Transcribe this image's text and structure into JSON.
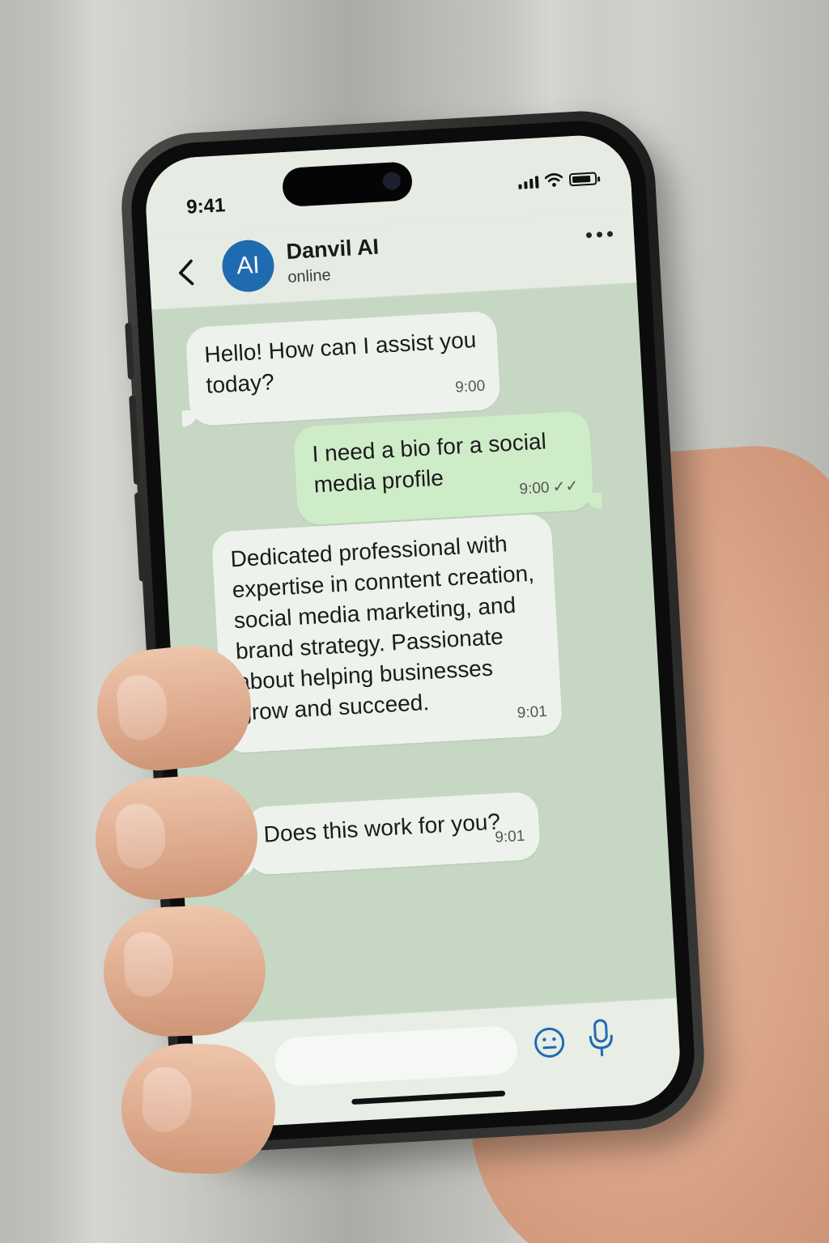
{
  "status_bar": {
    "time": "9:41"
  },
  "header": {
    "avatar_initials": "AI",
    "contact_name": "Danvil AI",
    "contact_status": "online"
  },
  "messages": [
    {
      "sender": "assistant",
      "text": "Hello! How can I assist you today?",
      "time": "9:00"
    },
    {
      "sender": "user",
      "text": "I need a bio for a social media profile",
      "time": "9:00",
      "status": "✓✓"
    },
    {
      "sender": "assistant",
      "text": "Dedicated professional with expertise in conntent creation, social media marketing, and brand strategy. Passionate about helping businesses grow and succeed.",
      "time": "9:01"
    },
    {
      "sender": "assistant",
      "text": "Does this work for you?",
      "time": "9:01"
    }
  ],
  "input": {
    "value": "",
    "placeholder": ""
  },
  "colors": {
    "accent": "#1f6bb0",
    "chat_background": "#c6d8c4",
    "incoming_bubble": "#eef2ec",
    "outgoing_bubble": "#cfecc9"
  },
  "icons": [
    "back-chevron",
    "more-dots",
    "plus",
    "emoji-smile",
    "microphone",
    "signal",
    "wifi",
    "battery"
  ]
}
